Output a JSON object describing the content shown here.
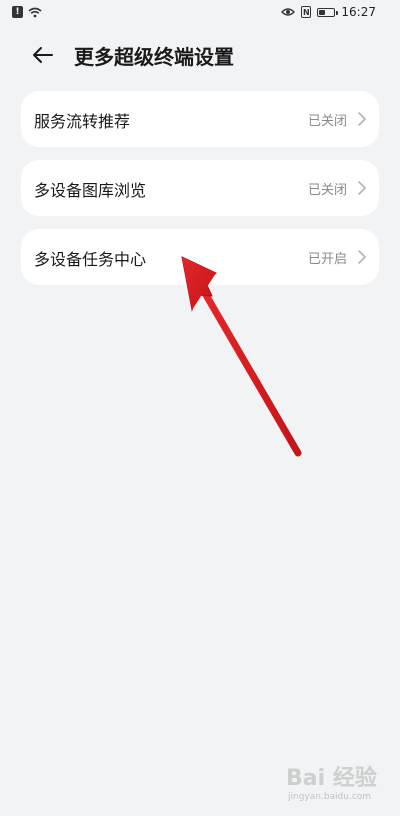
{
  "status_bar": {
    "time": "16:27",
    "alert_glyph": "!",
    "nfc_glyph": "N",
    "battery_level": 0.45
  },
  "header": {
    "title": "更多超级终端设置"
  },
  "settings": [
    {
      "label": "服务流转推荐",
      "status": "已关闭"
    },
    {
      "label": "多设备图库浏览",
      "status": "已关闭"
    },
    {
      "label": "多设备任务中心",
      "status": "已开启"
    }
  ],
  "watermark": {
    "text": "Bai  经验",
    "sub": "jingyan.baidu.com"
  },
  "colors": {
    "background": "#f1f3f5",
    "card": "#ffffff",
    "status_text": "#8a8a8a",
    "arrow": "#d81e22"
  }
}
